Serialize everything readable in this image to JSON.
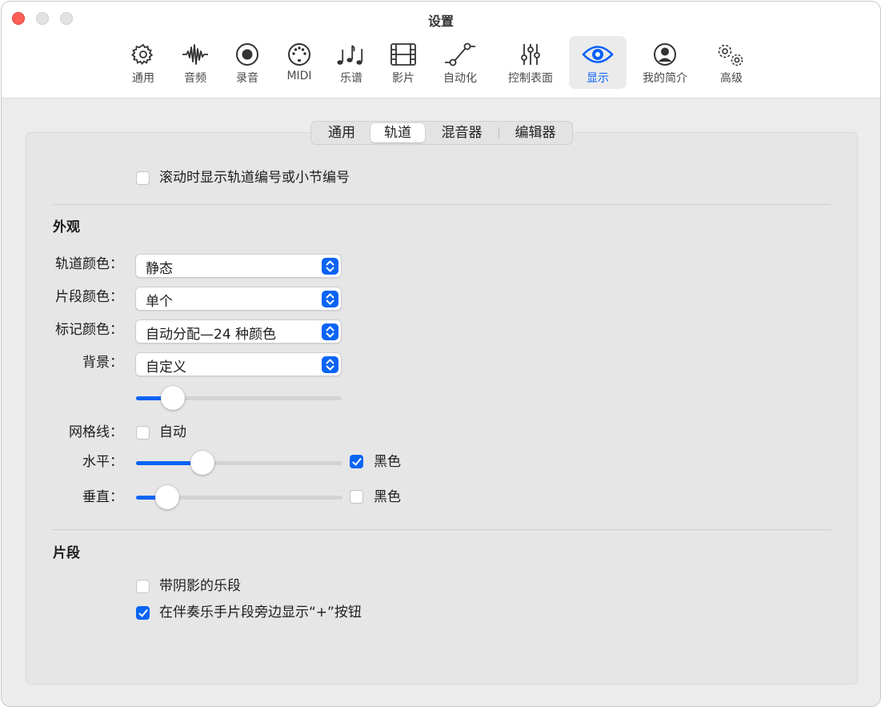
{
  "window": {
    "title": "设置"
  },
  "toolbar": {
    "items": [
      {
        "label": "通用",
        "icon": "gear-icon"
      },
      {
        "label": "音频",
        "icon": "waveform-icon"
      },
      {
        "label": "录音",
        "icon": "record-icon"
      },
      {
        "label": "MIDI",
        "icon": "midi-icon"
      },
      {
        "label": "乐谱",
        "icon": "music-notes-icon"
      },
      {
        "label": "影片",
        "icon": "film-icon"
      },
      {
        "label": "自动化",
        "icon": "automation-icon"
      },
      {
        "label": "控制表面",
        "icon": "sliders-icon"
      },
      {
        "label": "显示",
        "icon": "eye-icon",
        "active": true
      },
      {
        "label": "我的简介",
        "icon": "person-icon"
      },
      {
        "label": "高级",
        "icon": "gears-icon"
      }
    ]
  },
  "tabs": [
    "通用",
    "轨道",
    "混音器",
    "编辑器"
  ],
  "active_tab": "轨道",
  "scroll_option": {
    "label": "滚动时显示轨道编号或小节编号",
    "checked": false
  },
  "appearance": {
    "heading": "外观",
    "track_color": {
      "label": "轨道颜色：",
      "value": "静态"
    },
    "region_color": {
      "label": "片段颜色：",
      "value": "单个"
    },
    "marker_color": {
      "label": "标记颜色：",
      "value": "自动分配—24 种颜色"
    },
    "background": {
      "label": "背景：",
      "value": "自定义",
      "slider_level_pct": 18
    },
    "gridlines": {
      "label": "网格线：",
      "auto_label": "自动",
      "auto_checked": false
    },
    "horizontal": {
      "label": "水平：",
      "level_pct": 32,
      "black_label": "黑色",
      "black_checked": true
    },
    "vertical": {
      "label": "垂直：",
      "level_pct": 15,
      "black_label": "黑色",
      "black_checked": false
    }
  },
  "regions": {
    "heading": "片段",
    "shaded": {
      "label": "带阴影的乐段",
      "checked": false
    },
    "plus_button": {
      "label": "在伴奏乐手片段旁边显示“+”按钮",
      "checked": true
    }
  },
  "colors": {
    "accent": "#0a64f5",
    "close": "#ff5f57"
  }
}
